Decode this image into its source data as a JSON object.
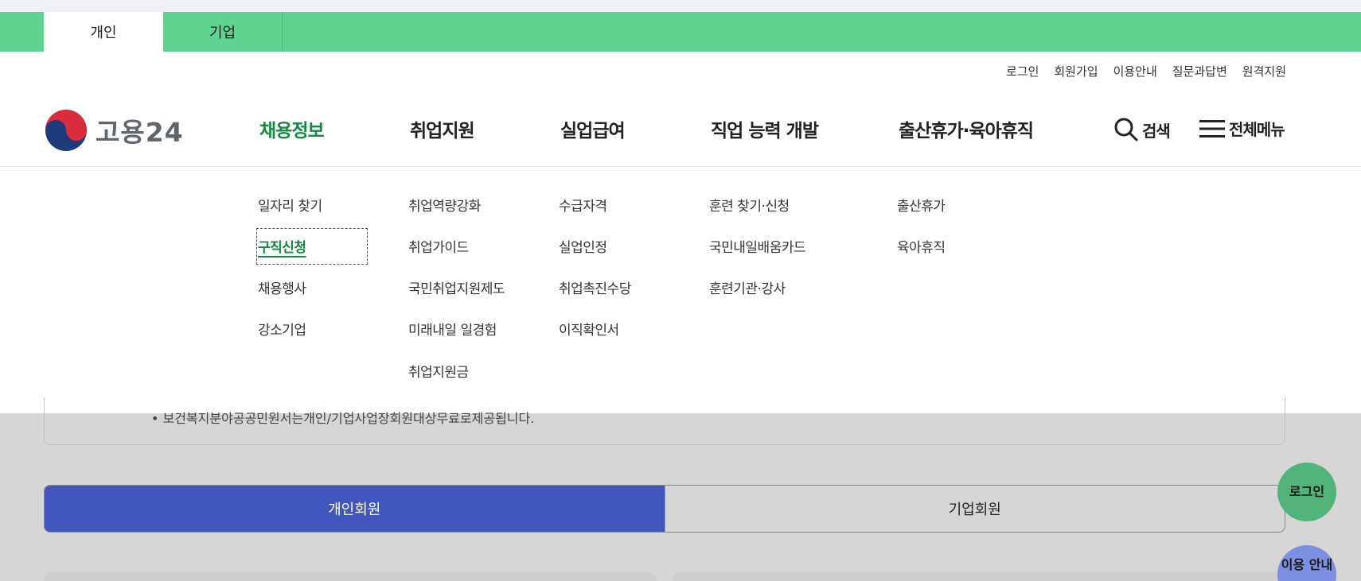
{
  "user_tabs": {
    "personal": "개인",
    "corporate": "기업"
  },
  "util_links": [
    "로그인",
    "회원가입",
    "이용안내",
    "질문과답변",
    "원격지원"
  ],
  "logo": {
    "text": "고용24"
  },
  "gnb": [
    "채용정보",
    "취업지원",
    "실업급여",
    "직업 능력 개발",
    "출산휴가·육아휴직"
  ],
  "tools": {
    "search": "검색",
    "all_menu": "전체메뉴"
  },
  "submenu": {
    "col1": [
      "일자리 찾기",
      "구직신청",
      "채용행사",
      "강소기업"
    ],
    "col2": [
      "취업역량강화",
      "취업가이드",
      "국민취업지원제도",
      "미래내일 일경험",
      "취업지원금"
    ],
    "col3": [
      "수급자격",
      "실업인정",
      "취업촉진수당",
      "이직확인서"
    ],
    "col4": [
      "훈련 찾기·신청",
      "국민내일배움카드",
      "훈련기관·강사"
    ],
    "col5": [
      "출산휴가",
      "육아휴직"
    ]
  },
  "notice": {
    "text": "• 보건복지분야공공민원서는개인/기업사업장회원대상무료로제공됩니다."
  },
  "member_tabs": {
    "personal": "개인회원",
    "corporate": "기업회원"
  },
  "floating": {
    "login": "로그인",
    "guide": "이용 안내"
  },
  "colors": {
    "green_bar": "#5fd490",
    "active_menu": "#128a3f",
    "active_member_tab": "#4056bd"
  }
}
